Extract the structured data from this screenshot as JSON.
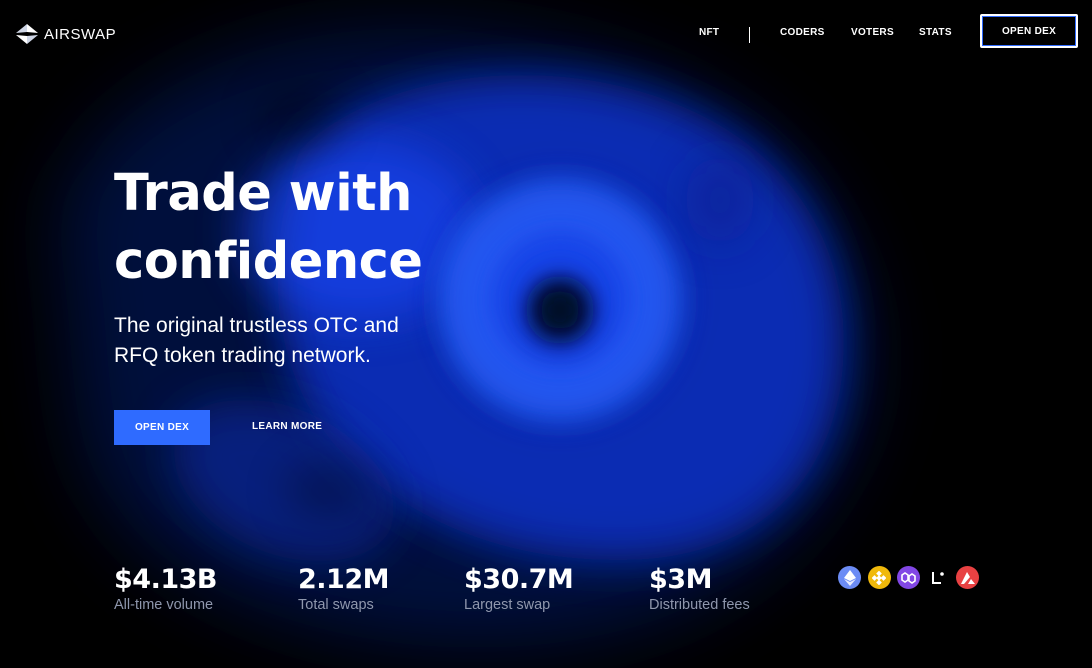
{
  "header": {
    "brand": "AIRSWAP",
    "nav": [
      {
        "label": "NFT"
      },
      {
        "label": "CODERS"
      },
      {
        "label": "VOTERS"
      },
      {
        "label": "STATS"
      }
    ],
    "open_dex_label": "OPEN DEX"
  },
  "hero": {
    "title_line1": "Trade with",
    "title_line2": "confidence",
    "subtitle_line1": "The original trustless OTC and",
    "subtitle_line2": "RFQ token trading network.",
    "primary_button": "OPEN DEX",
    "secondary_button": "LEARN MORE"
  },
  "stats": [
    {
      "value": "$4.13B",
      "label": "All-time volume"
    },
    {
      "value": "2.12M",
      "label": "Total swaps"
    },
    {
      "value": "$30.7M",
      "label": "Largest swap"
    },
    {
      "value": "$3M",
      "label": "Distributed fees"
    }
  ],
  "chains": [
    {
      "icon": "ethereum-icon",
      "color": "#6c8cf5"
    },
    {
      "icon": "bnb-icon",
      "color": "#f0b90b"
    },
    {
      "icon": "polygon-icon",
      "color": "#8247e5"
    },
    {
      "icon": "linea-icon",
      "color": "#ffffff"
    },
    {
      "icon": "avalanche-icon",
      "color": "#e84142"
    }
  ],
  "colors": {
    "accent": "#2f6bff",
    "background": "#000000",
    "muted_text": "#8f97ad"
  }
}
